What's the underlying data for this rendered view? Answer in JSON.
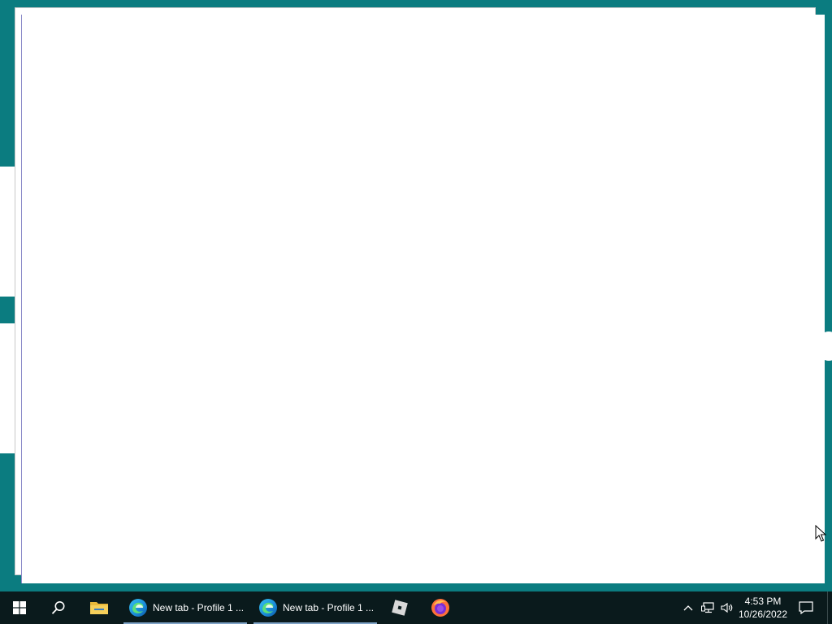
{
  "screen": {
    "wallpaper_color": "#0b7c80",
    "taskbar_color": "#0a1a1c",
    "accent_underline": "#7fa3c7"
  },
  "windows": [
    {
      "name": "browser-window-back",
      "content": "blank"
    },
    {
      "name": "browser-window-front",
      "content": "blank"
    }
  ],
  "taskbar": {
    "start_icon": "windows-logo-icon",
    "search_icon": "search-icon",
    "pinned": [
      {
        "icon": "file-explorer-icon"
      },
      {
        "icon": "edge-icon",
        "label": "New tab - Profile 1 ...",
        "active": true
      },
      {
        "icon": "edge-icon",
        "label": "New tab - Profile 1 ...",
        "active": true
      },
      {
        "icon": "roblox-icon"
      },
      {
        "icon": "firefox-icon"
      }
    ],
    "tray": {
      "icons": [
        "chevron-up-icon",
        "network-icon",
        "volume-icon"
      ],
      "time": "4:53 PM",
      "date": "10/26/2022",
      "notification_icon": "notification-icon"
    }
  }
}
